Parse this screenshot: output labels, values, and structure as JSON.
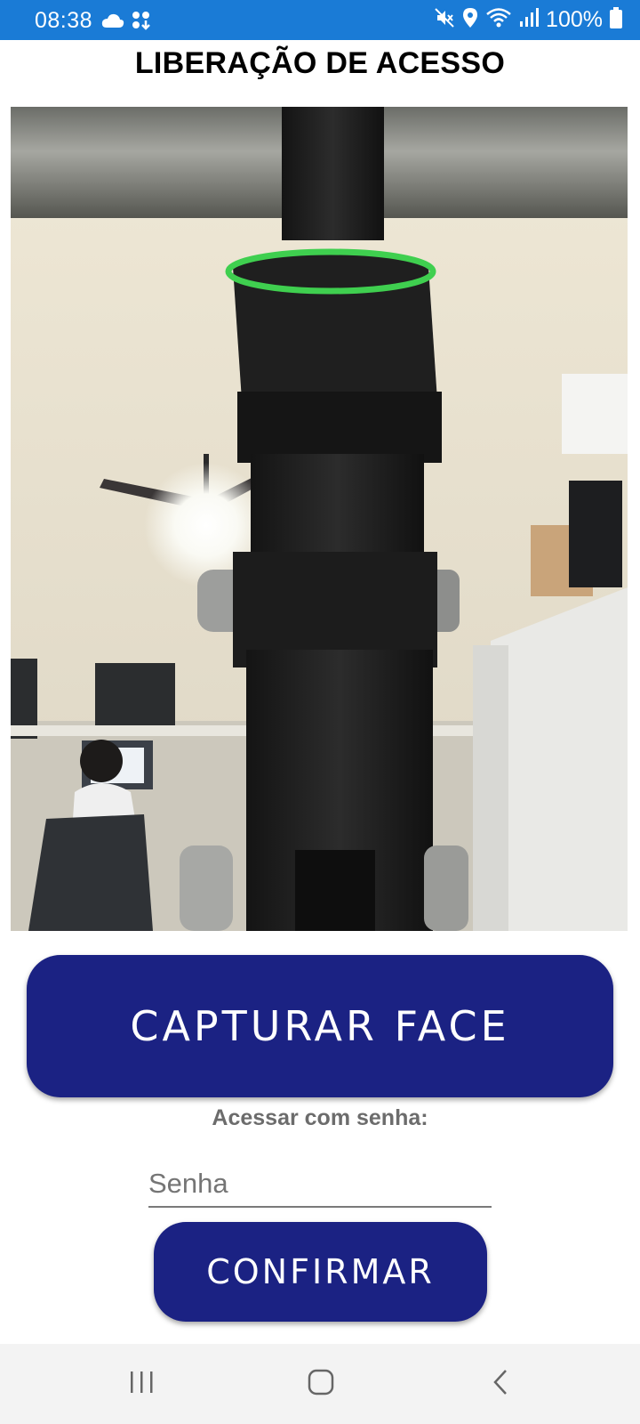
{
  "status_bar": {
    "time": "08:38",
    "battery": "100%",
    "background_color": "#1a7bd6",
    "left_icons": [
      "cloud-icon",
      "app-grid-icon"
    ],
    "right_icons": [
      "mute-icon",
      "location-icon",
      "wifi-icon",
      "signal-icon",
      "battery-icon"
    ]
  },
  "header": {
    "title": "LIBERAÇÃO DE ACESSO"
  },
  "camera_preview": {
    "content": "live-camera-feed"
  },
  "actions": {
    "capture_label": "CAPTURAR FACE",
    "password_prompt": "Acessar com senha:",
    "password_placeholder": "Senha",
    "password_value": "",
    "confirm_label": "CONFIRMAR",
    "button_color": "#1b2283"
  },
  "nav_bar": {
    "icons": [
      "recent-apps-icon",
      "home-icon",
      "back-icon"
    ]
  }
}
